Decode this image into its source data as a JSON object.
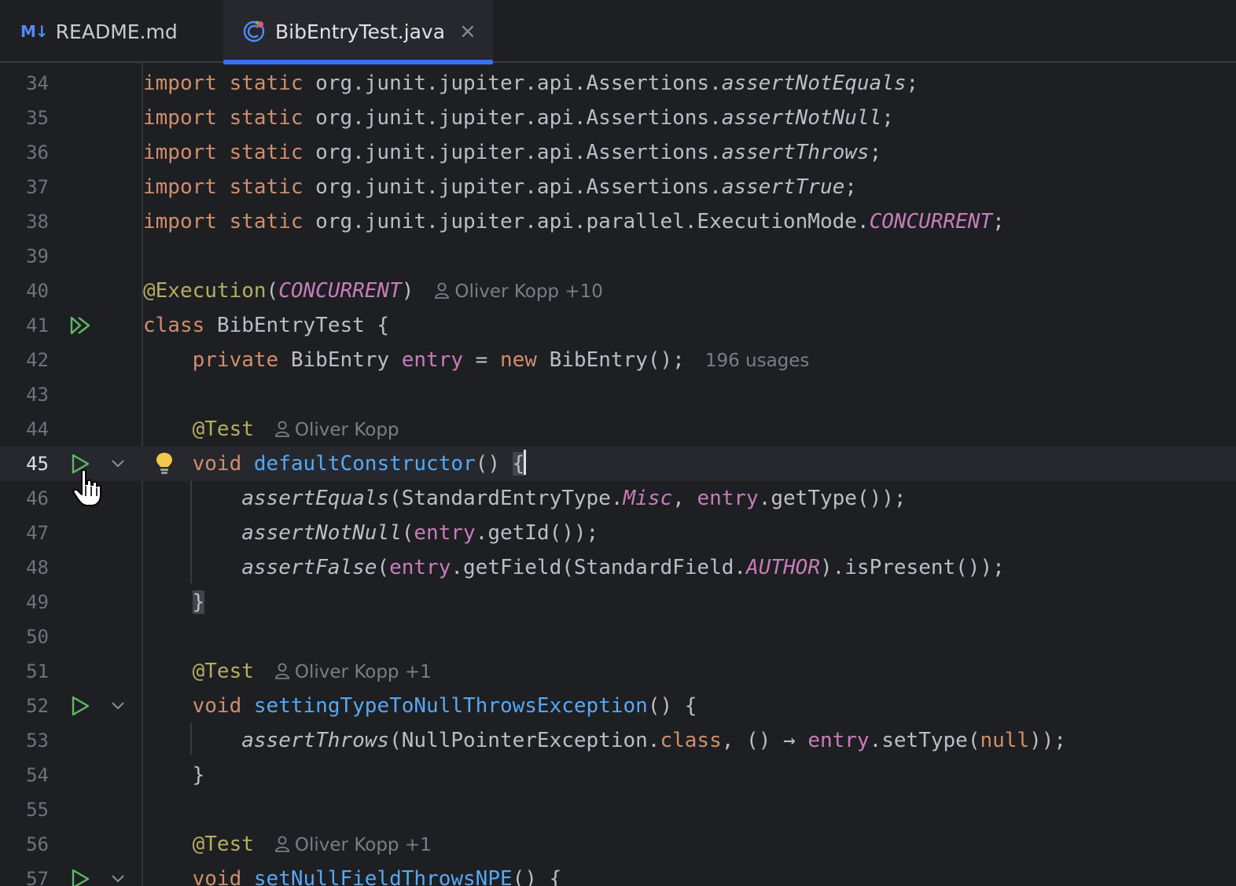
{
  "tabs": [
    {
      "label": "README.md",
      "icon": "markdown-icon",
      "icon_text": "M↓",
      "active": false
    },
    {
      "label": "BibEntryTest.java",
      "icon": "java-class-icon",
      "active": true,
      "close": "×"
    }
  ],
  "colors": {
    "accent": "#3574f0",
    "keyword": "#cf8e6d",
    "annotation": "#b3ae60",
    "field": "#c77dbb",
    "function": "#56a8f5",
    "run": "#5fb865"
  },
  "editor": {
    "current_line": 45,
    "lines": {
      "l34": {
        "n": "34",
        "a": "import",
        "b": "static",
        "c": "org.junit.jupiter.api.Assertions.",
        "d": "assertNotEquals",
        "e": ";"
      },
      "l35": {
        "n": "35",
        "a": "import",
        "b": "static",
        "c": "org.junit.jupiter.api.Assertions.",
        "d": "assertNotNull",
        "e": ";"
      },
      "l36": {
        "n": "36",
        "a": "import",
        "b": "static",
        "c": "org.junit.jupiter.api.Assertions.",
        "d": "assertThrows",
        "e": ";"
      },
      "l37": {
        "n": "37",
        "a": "import",
        "b": "static",
        "c": "org.junit.jupiter.api.Assertions.",
        "d": "assertTrue",
        "e": ";"
      },
      "l38": {
        "n": "38",
        "a": "import",
        "b": "static",
        "c": "org.junit.jupiter.api.parallel.ExecutionMode.",
        "d": "CONCURRENT",
        "e": ";"
      },
      "l39": {
        "n": "39"
      },
      "l40": {
        "n": "40",
        "a": "@Execution",
        "b": "(",
        "c": "CONCURRENT",
        "d": ")",
        "hint": "Oliver Kopp +10"
      },
      "l41": {
        "n": "41",
        "a": "class",
        "b": " BibEntryTest {"
      },
      "l42": {
        "n": "42",
        "a": "private",
        "b": " BibEntry ",
        "c": "entry",
        "d": " = ",
        "e": "new",
        "f": " BibEntry();",
        "hint": "196 usages"
      },
      "l43": {
        "n": "43"
      },
      "l44": {
        "n": "44",
        "a": "@Test",
        "hint": "Oliver Kopp"
      },
      "l45": {
        "n": "45",
        "a": "void",
        "b": "defaultConstructor",
        "c": "() ",
        "d": "{"
      },
      "l46": {
        "n": "46",
        "a": "assertEquals",
        "b": "(StandardEntryType.",
        "c": "Misc",
        "d": ", ",
        "e": "entry",
        "f": ".getType());"
      },
      "l47": {
        "n": "47",
        "a": "assertNotNull",
        "b": "(",
        "c": "entry",
        "d": ".getId());"
      },
      "l48": {
        "n": "48",
        "a": "assertFalse",
        "b": "(",
        "c": "entry",
        "d": ".getField(StandardField.",
        "e": "AUTHOR",
        "f": ").isPresent());"
      },
      "l49": {
        "n": "49",
        "a": "}"
      },
      "l50": {
        "n": "50"
      },
      "l51": {
        "n": "51",
        "a": "@Test",
        "hint": "Oliver Kopp +1"
      },
      "l52": {
        "n": "52",
        "a": "void",
        "b": "settingTypeToNullThrowsException",
        "c": "() {"
      },
      "l53": {
        "n": "53",
        "a": "assertThrows",
        "b": "(NullPointerException.",
        "c": "class",
        "d": ", () → ",
        "e": "entry",
        "f": ".setType(",
        "g": "null",
        "h": "));"
      },
      "l54": {
        "n": "54",
        "a": "}"
      },
      "l55": {
        "n": "55"
      },
      "l56": {
        "n": "56",
        "a": "@Test",
        "hint": "Oliver Kopp +1"
      },
      "l57": {
        "n": "57",
        "a": "void",
        "b": "setNullFieldThrowsNPE",
        "c": "() {"
      }
    }
  }
}
